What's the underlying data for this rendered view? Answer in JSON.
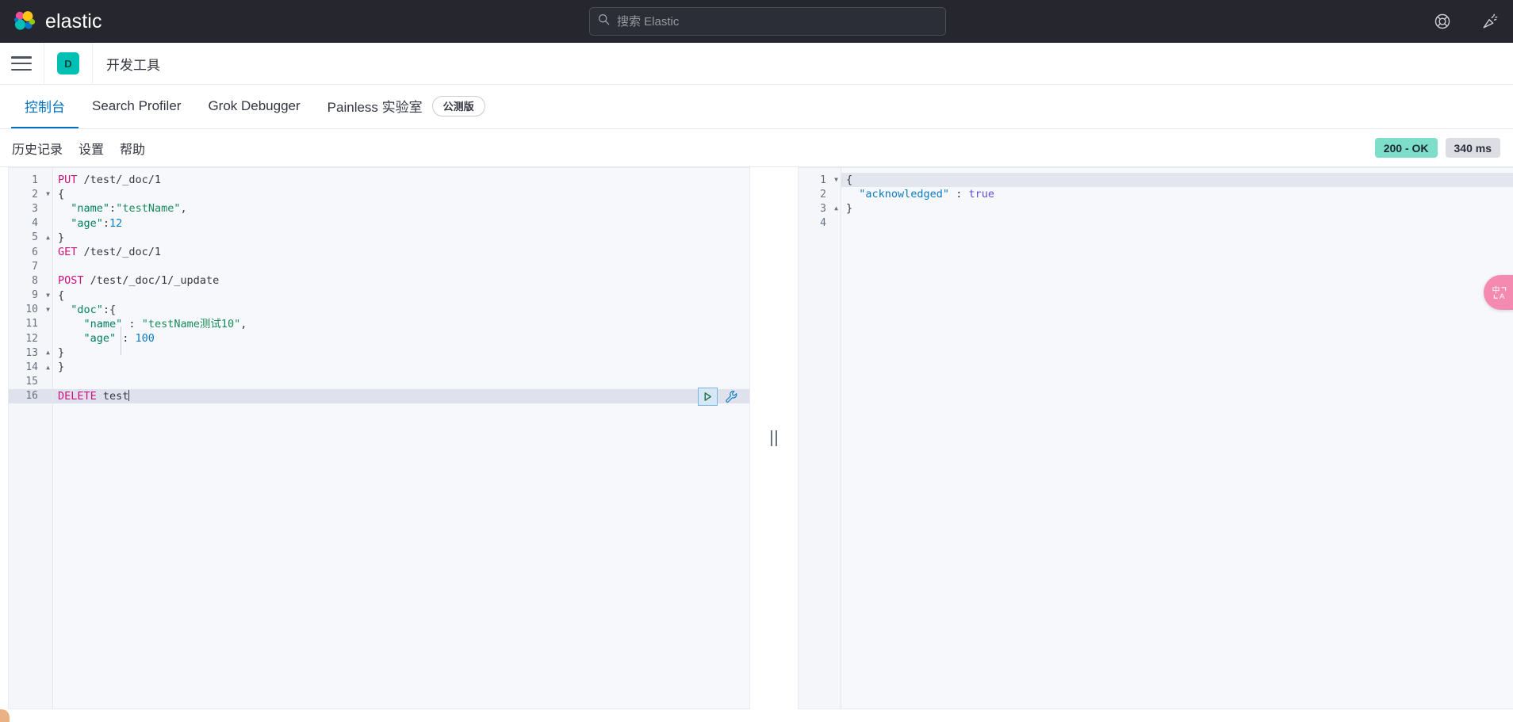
{
  "header": {
    "brand_name": "elastic",
    "logo_icon": "elastic-logo-icon",
    "search": {
      "placeholder": "搜索 Elastic",
      "value": "",
      "icon": "search-icon"
    },
    "actions": [
      {
        "name": "help-icon",
        "label": "帮助"
      },
      {
        "name": "whats-new-icon",
        "label": "新功能"
      }
    ]
  },
  "breadcrumb": {
    "nav_toggle_icon": "hamburger-menu-icon",
    "space_avatar": "D",
    "title": "开发工具"
  },
  "app_tabs": [
    {
      "label": "控制台",
      "active": true,
      "name": "tab-console"
    },
    {
      "label": "Search Profiler",
      "active": false,
      "name": "tab-search-profiler"
    },
    {
      "label": "Grok Debugger",
      "active": false,
      "name": "tab-grok-debugger"
    },
    {
      "label": "Painless 实验室",
      "active": false,
      "name": "tab-painless-lab",
      "badge": "公测版"
    }
  ],
  "console_toolbar": {
    "links": [
      {
        "label": "历史记录",
        "name": "console-history-link"
      },
      {
        "label": "设置",
        "name": "console-settings-link"
      },
      {
        "label": "帮助",
        "name": "console-help-link"
      }
    ],
    "status_code": "200 - OK",
    "status_time": "340 ms",
    "status_code_color": "#7ddfca",
    "status_time_color": "#dcdee4"
  },
  "request_editor": {
    "name": "request-editor",
    "active_line": 16,
    "lines": [
      {
        "n": 1,
        "fold": "",
        "tokens": [
          {
            "t": "method",
            "v": "PUT"
          },
          {
            "t": "url",
            "v": " /test/_doc/1"
          }
        ]
      },
      {
        "n": 2,
        "fold": "open",
        "tokens": [
          {
            "t": "punct",
            "v": "{"
          }
        ]
      },
      {
        "n": 3,
        "fold": "",
        "tokens": [
          {
            "t": "punct",
            "v": "  "
          },
          {
            "t": "key",
            "v": "\"name\""
          },
          {
            "t": "punct",
            "v": ":"
          },
          {
            "t": "str",
            "v": "\"testName\""
          },
          {
            "t": "punct",
            "v": ","
          }
        ]
      },
      {
        "n": 4,
        "fold": "",
        "tokens": [
          {
            "t": "punct",
            "v": "  "
          },
          {
            "t": "key",
            "v": "\"age\""
          },
          {
            "t": "punct",
            "v": ":"
          },
          {
            "t": "num",
            "v": "12"
          }
        ]
      },
      {
        "n": 5,
        "fold": "close",
        "tokens": [
          {
            "t": "punct",
            "v": "}"
          }
        ]
      },
      {
        "n": 6,
        "fold": "",
        "tokens": [
          {
            "t": "method",
            "v": "GET"
          },
          {
            "t": "url",
            "v": " /test/_doc/1"
          }
        ]
      },
      {
        "n": 7,
        "fold": "",
        "tokens": [
          {
            "t": "punct",
            "v": ""
          }
        ]
      },
      {
        "n": 8,
        "fold": "",
        "tokens": [
          {
            "t": "method",
            "v": "POST"
          },
          {
            "t": "url",
            "v": " /test/_doc/1/_update"
          }
        ]
      },
      {
        "n": 9,
        "fold": "open",
        "tokens": [
          {
            "t": "punct",
            "v": "{"
          }
        ]
      },
      {
        "n": 10,
        "fold": "open",
        "tokens": [
          {
            "t": "punct",
            "v": "  "
          },
          {
            "t": "key",
            "v": "\"doc\""
          },
          {
            "t": "punct",
            "v": ":{"
          }
        ]
      },
      {
        "n": 11,
        "fold": "",
        "tokens": [
          {
            "t": "punct",
            "v": "    "
          },
          {
            "t": "key",
            "v": "\"name\""
          },
          {
            "t": "punct",
            "v": " : "
          },
          {
            "t": "str",
            "v": "\"testName测试10\""
          },
          {
            "t": "punct",
            "v": ","
          }
        ]
      },
      {
        "n": 12,
        "fold": "",
        "tokens": [
          {
            "t": "punct",
            "v": "    "
          },
          {
            "t": "key",
            "v": "\"age\""
          },
          {
            "t": "punct",
            "v": " : "
          },
          {
            "t": "num",
            "v": "100"
          }
        ]
      },
      {
        "n": 13,
        "fold": "close",
        "tokens": [
          {
            "t": "punct",
            "v": "}"
          }
        ]
      },
      {
        "n": 14,
        "fold": "close",
        "tokens": [
          {
            "t": "punct",
            "v": "}"
          }
        ]
      },
      {
        "n": 15,
        "fold": "",
        "tokens": [
          {
            "t": "punct",
            "v": ""
          }
        ]
      },
      {
        "n": 16,
        "fold": "",
        "caret": true,
        "tokens": [
          {
            "t": "method",
            "v": "DELETE"
          },
          {
            "t": "url",
            "v": " test"
          }
        ]
      }
    ]
  },
  "run_actions": {
    "play_button_label": "运行",
    "play_icon": "play-icon",
    "wrench_icon": "wrench-icon"
  },
  "response_editor": {
    "name": "response-editor",
    "lines": [
      {
        "n": 1,
        "fold": "open",
        "tokens": [
          {
            "t": "punct",
            "v": "{"
          }
        ]
      },
      {
        "n": 2,
        "fold": "",
        "tokens": [
          {
            "t": "punct",
            "v": "  "
          },
          {
            "t": "respkey",
            "v": "\"acknowledged\""
          },
          {
            "t": "punct",
            "v": " : "
          },
          {
            "t": "bool",
            "v": "true"
          }
        ]
      },
      {
        "n": 3,
        "fold": "close",
        "tokens": [
          {
            "t": "punct",
            "v": "}"
          }
        ]
      },
      {
        "n": 4,
        "fold": "",
        "tokens": [
          {
            "t": "punct",
            "v": ""
          }
        ]
      }
    ]
  },
  "splitter": {
    "name": "pane-splitter",
    "icon": "grip-vertical-icon"
  },
  "translate_fab": {
    "name": "translate-button",
    "icon": "translate-icon",
    "color": "#f58ab0"
  }
}
